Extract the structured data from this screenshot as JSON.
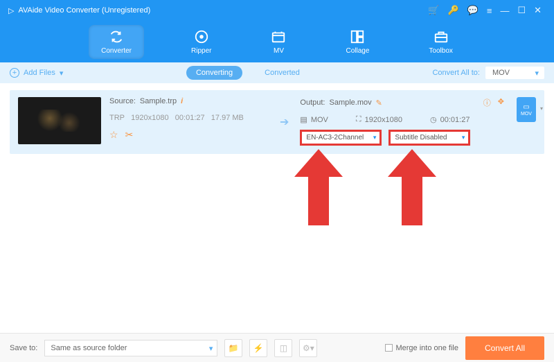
{
  "title": "AVAide Video Converter (Unregistered)",
  "toolbar": {
    "items": [
      "Converter",
      "Ripper",
      "MV",
      "Collage",
      "Toolbox"
    ],
    "active": 0
  },
  "subbar": {
    "addFiles": "Add Files",
    "tabs": [
      "Converting",
      "Converted"
    ],
    "activeTab": 0,
    "convertAllLabel": "Convert All to:",
    "convertAllFormat": "MOV"
  },
  "item": {
    "sourceLabel": "Source:",
    "sourceFile": "Sample.trp",
    "srcFormat": "TRP",
    "srcRes": "1920x1080",
    "srcDur": "00:01:27",
    "srcSize": "17.97 MB",
    "outputLabel": "Output:",
    "outputFile": "Sample.mov",
    "outFormat": "MOV",
    "outRes": "1920x1080",
    "outDur": "00:01:27",
    "audioSel": "EN-AC3-2Channel",
    "subtitleSel": "Subtitle Disabled",
    "badge": "MOV"
  },
  "footer": {
    "saveToLabel": "Save to:",
    "saveToVal": "Same as source folder",
    "mergeLabel": "Merge into one file",
    "convertBtn": "Convert All"
  }
}
